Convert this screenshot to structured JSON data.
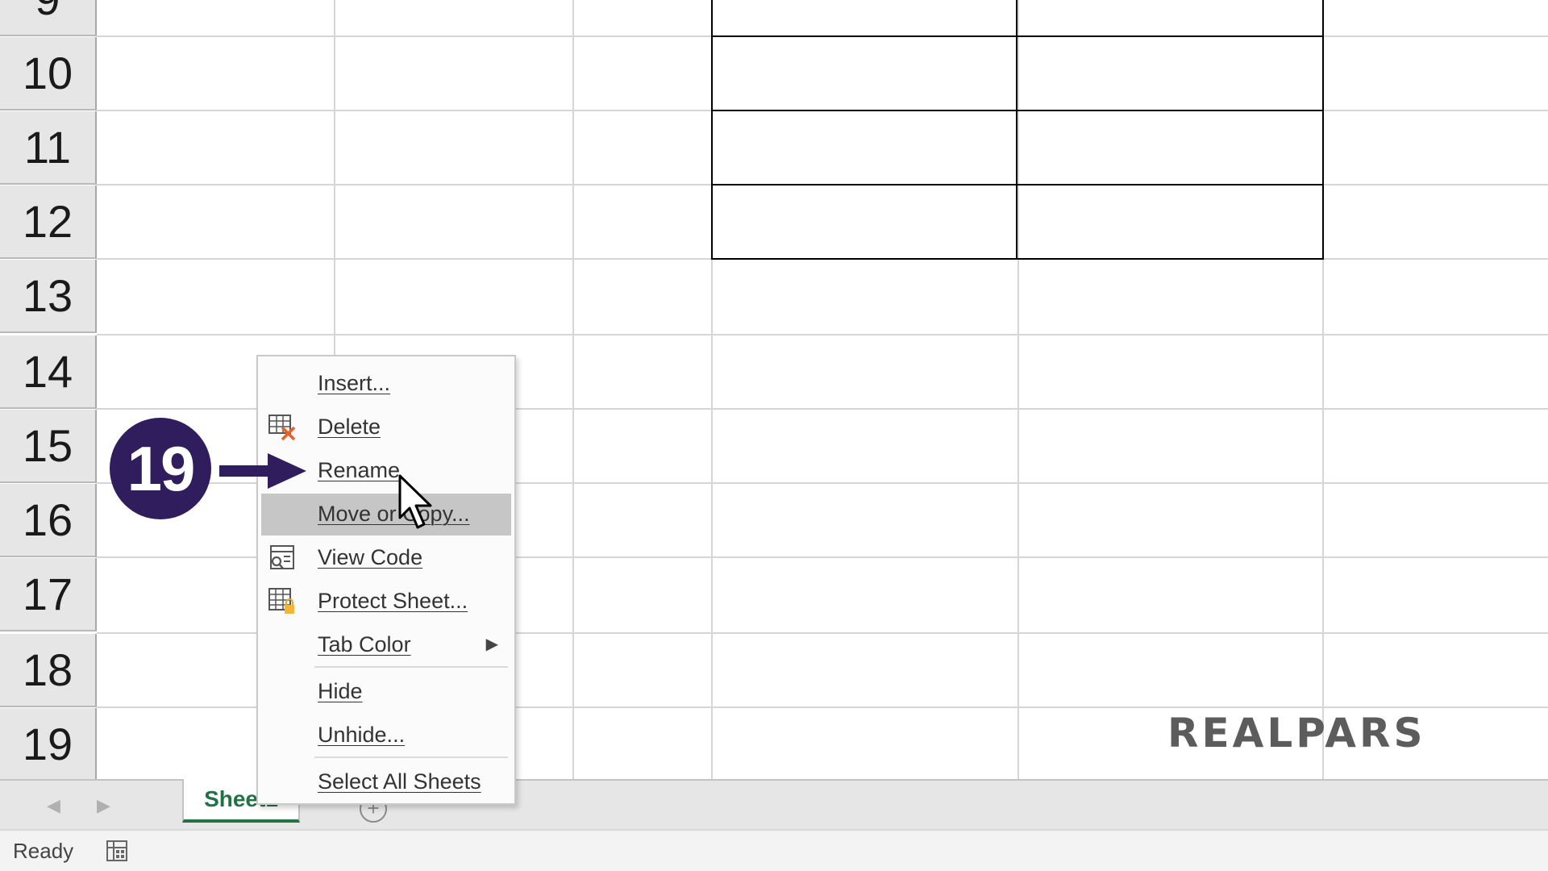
{
  "worksheet": {
    "row_numbers": [
      "9",
      "10",
      "11",
      "12",
      "13",
      "14",
      "15",
      "16",
      "17",
      "18",
      "19"
    ]
  },
  "sheet_tabs": {
    "tab_label": "Sheet1",
    "prev_arrow": "◀",
    "next_arrow": "▶",
    "add_label": "+"
  },
  "status_bar": {
    "status_text": "Ready",
    "macro_icon": "macro-record-icon"
  },
  "context_menu": {
    "items": [
      {
        "label": "Insert...",
        "icon": null,
        "highlighted": false
      },
      {
        "label": "Delete",
        "icon": "delete-sheet-icon",
        "highlighted": false
      },
      {
        "label": "Rename",
        "icon": null,
        "highlighted": false
      },
      {
        "label": "Move or Copy...",
        "icon": null,
        "highlighted": true
      },
      {
        "label": "View Code",
        "icon": "view-code-icon",
        "highlighted": false
      },
      {
        "label": "Protect Sheet...",
        "icon": "protect-sheet-icon",
        "highlighted": false
      },
      {
        "label": "Tab Color",
        "icon": null,
        "highlighted": false,
        "submenu_arrow": "▶"
      },
      {
        "label": "Hide",
        "icon": null,
        "highlighted": false
      },
      {
        "label": "Unhide...",
        "icon": null,
        "highlighted": false
      },
      {
        "label": "Select All Sheets",
        "icon": null,
        "highlighted": false
      }
    ]
  },
  "annotation": {
    "step_number": "19",
    "badge_color": "#2f1d5e",
    "arrow_color": "#2f1d5e"
  },
  "watermark": {
    "text": "REALPARS"
  },
  "colors": {
    "sheet_tab_accent": "#217346",
    "menu_highlight": "#c6c6c6"
  }
}
